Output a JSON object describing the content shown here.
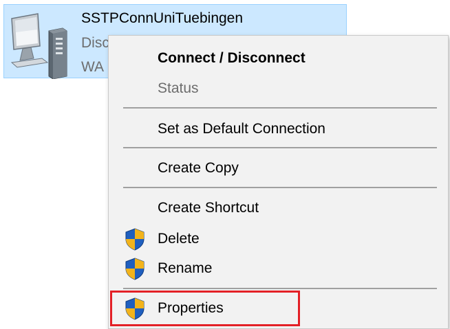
{
  "connection": {
    "name": "SSTPConnUniTuebingen",
    "status_partial": "Disc",
    "device_partial": "WA",
    "icon": "network-connection-icon",
    "selected_color": "#cce8ff"
  },
  "context_menu": {
    "items": [
      {
        "label": "Connect / Disconnect",
        "style": "bold"
      },
      {
        "label": "Status",
        "style": "disabled"
      },
      {
        "label": "Set as Default Connection",
        "style": "normal"
      },
      {
        "label": "Create Copy",
        "style": "normal"
      },
      {
        "label": "Create Shortcut",
        "style": "normal"
      },
      {
        "label": "Delete",
        "style": "normal",
        "icon": "uac-shield-icon"
      },
      {
        "label": "Rename",
        "style": "normal",
        "icon": "uac-shield-icon"
      },
      {
        "label": "Properties",
        "style": "normal",
        "icon": "uac-shield-icon",
        "highlighted": true
      }
    ],
    "highlight_color": "#e32026"
  }
}
